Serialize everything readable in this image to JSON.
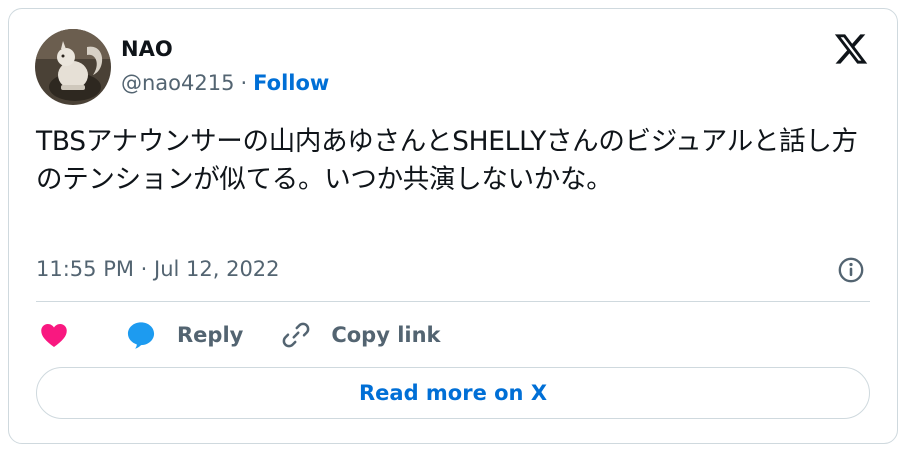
{
  "author": {
    "name": "NAO",
    "handle": "@nao4215",
    "separator": "·",
    "follow_label": "Follow"
  },
  "tweet": {
    "text": "TBSアナウンサーの山内あゆさんとSHELLYさんのビジュアルと話し方のテンションが似てる。いつか共演しないかな。",
    "timestamp": "11:55 PM · Jul 12, 2022"
  },
  "actions": {
    "reply_label": "Reply",
    "copy_link_label": "Copy link"
  },
  "read_more_label": "Read more on X",
  "icons": {
    "logo": "x-logo-icon",
    "info": "info-icon",
    "like": "heart-icon",
    "reply": "speech-bubble-icon",
    "copy": "link-icon"
  },
  "colors": {
    "link_blue": "#006fd6",
    "like_red": "#f91880",
    "reply_blue": "#1d9bf0",
    "secondary_text": "#536471",
    "border": "#cfd9de"
  }
}
